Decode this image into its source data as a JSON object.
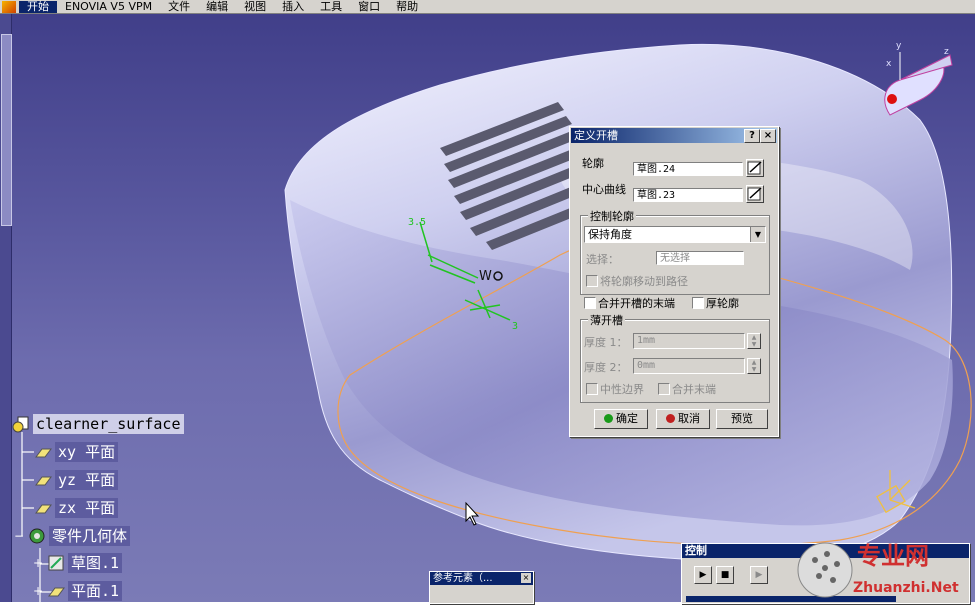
{
  "menu": {
    "items": [
      "开始",
      "ENOVIA V5 VPM",
      "文件",
      "编辑",
      "视图",
      "插入",
      "工具",
      "窗口",
      "帮助"
    ]
  },
  "viewport": {
    "sketch_labels": [
      "3.5",
      "3"
    ]
  },
  "dialog": {
    "title": "定义开槽",
    "help_btn": "?",
    "close_btn": "×",
    "profile_label": "轮廓",
    "profile_value": "草图.24",
    "center_curve_label": "中心曲线",
    "center_curve_value": "草图.23",
    "control_group": "控制轮廓",
    "control_option": "保持角度",
    "select_label": "选择：",
    "select_value": "无选择",
    "move_profile_label": "将轮廓移动到路径",
    "merge_ends_label": "合并开槽的末端",
    "thick_profile_label": "厚轮廓",
    "thin_group": "薄开槽",
    "thickness1_label": "厚度 1：",
    "thickness1_value": "1mm",
    "thickness2_label": "厚度 2：",
    "thickness2_value": "0mm",
    "neutral_label": "中性边界",
    "merge_tips_label": "合并末端",
    "ok": "确定",
    "cancel": "取消",
    "preview": "预览"
  },
  "tree": {
    "root": "clearner_surface",
    "items": [
      "xy 平面",
      "yz 平面",
      "zx 平面",
      "零件几何体",
      "草图.1",
      "平面.1"
    ]
  },
  "ref_panel": {
    "title": "参考元素（..."
  },
  "control_panel": {
    "title": "控制"
  },
  "watermark": {
    "line1": "专业网",
    "line2": "Zhuanzhi.Net"
  },
  "colors": {
    "accent": "#0a246a",
    "viewport": "#58579e",
    "sketch": "#21c421"
  }
}
